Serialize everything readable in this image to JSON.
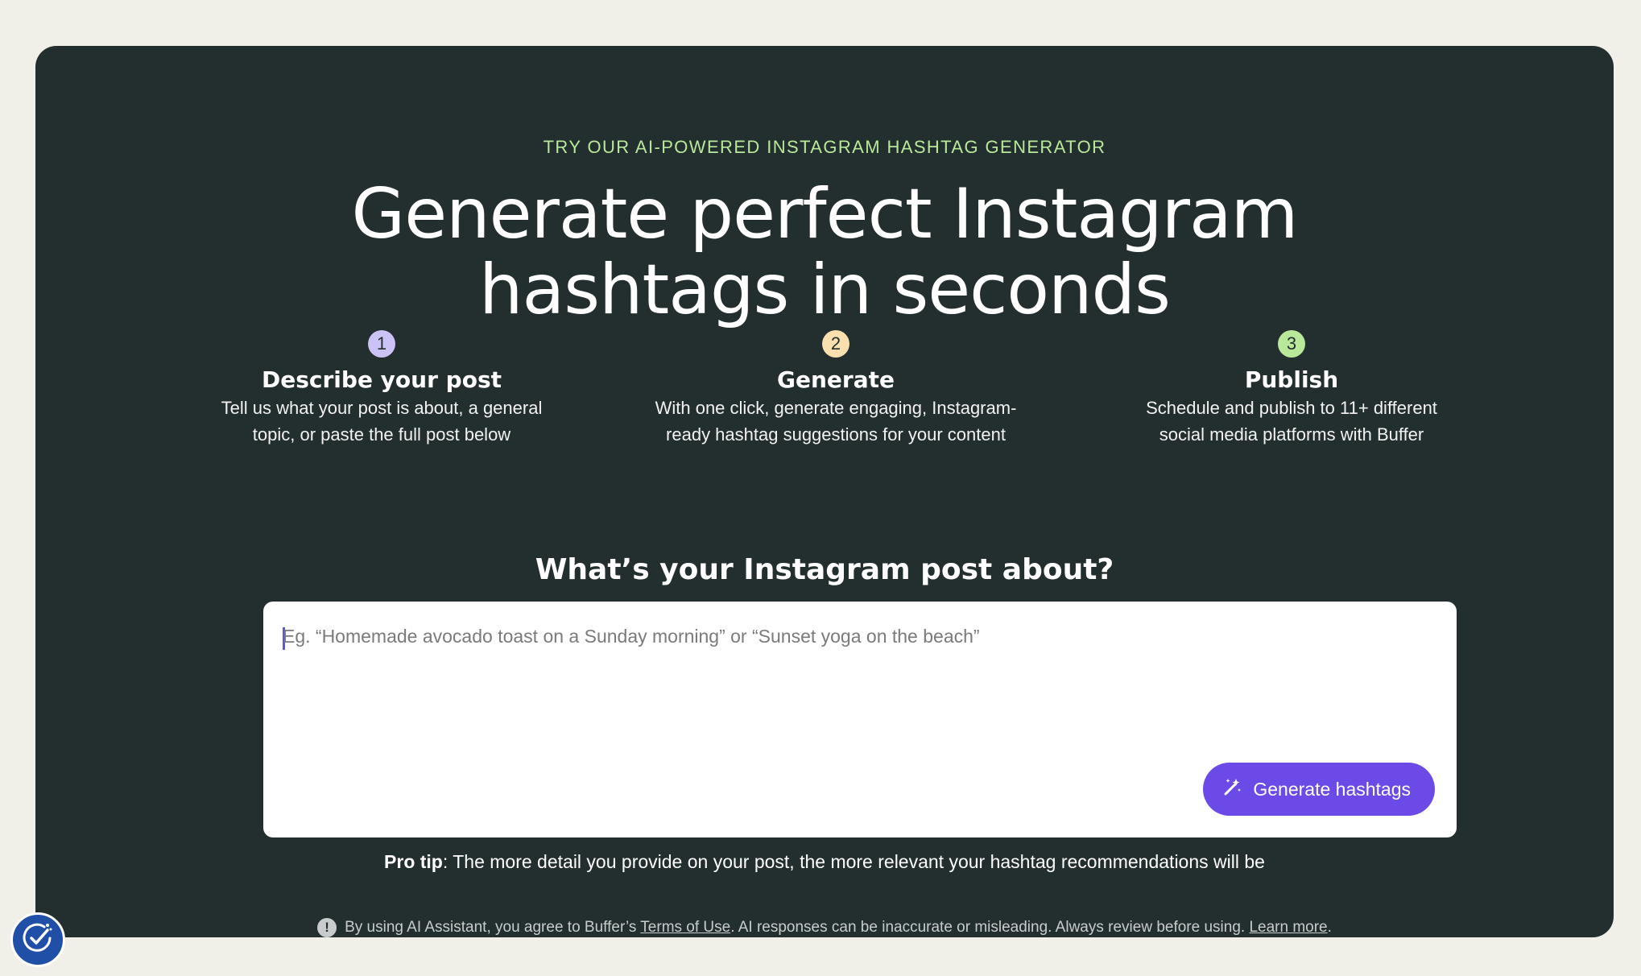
{
  "header": {
    "eyebrow": "TRY OUR AI-POWERED INSTAGRAM HASHTAG GENERATOR",
    "headline_line1": "Generate perfect Instagram",
    "headline_line2": "hashtags in seconds"
  },
  "steps": [
    {
      "number": "1",
      "title": "Describe your post",
      "desc_line1": "Tell us what your post is about, a general",
      "desc_line2": "topic, or paste the full post below",
      "color": "#cbc2f5"
    },
    {
      "number": "2",
      "title": "Generate",
      "desc_line1": "With one click, generate engaging, Instagram-",
      "desc_line2": "ready hashtag suggestions for your content",
      "color": "#fbdfae"
    },
    {
      "number": "3",
      "title": "Publish",
      "desc_line1": "Schedule and publish to 11+ different",
      "desc_line2": "social media platforms with Buffer",
      "color": "#b9e89a"
    }
  ],
  "form": {
    "question": "What’s your Instagram post about?",
    "placeholder": "Eg. “Homemade avocado toast on a Sunday morning” or “Sunset yoga on the beach”",
    "value": "",
    "button_label": "Generate hashtags",
    "button_icon": "magic-wand-icon"
  },
  "protip": {
    "label": "Pro tip",
    "text": ": The more detail you provide on your post, the more relevant your hashtag recommendations will be"
  },
  "disclaimer": {
    "icon": "exclamation-icon",
    "text_before": "By using AI Assistant, you agree to Buffer’s",
    "terms_link": "Terms of Use",
    "text_middle": ". AI responses can be inaccurate or misleading. Always review before using.",
    "learn_link": "Learn more",
    "text_end": "."
  },
  "accessibility_widget": {
    "icon": "accessibility-icon"
  },
  "colors": {
    "page_bg": "#f1f0e8",
    "panel_bg": "#232e2f",
    "eyebrow": "#b9e89a",
    "button": "#6b4ae8"
  }
}
